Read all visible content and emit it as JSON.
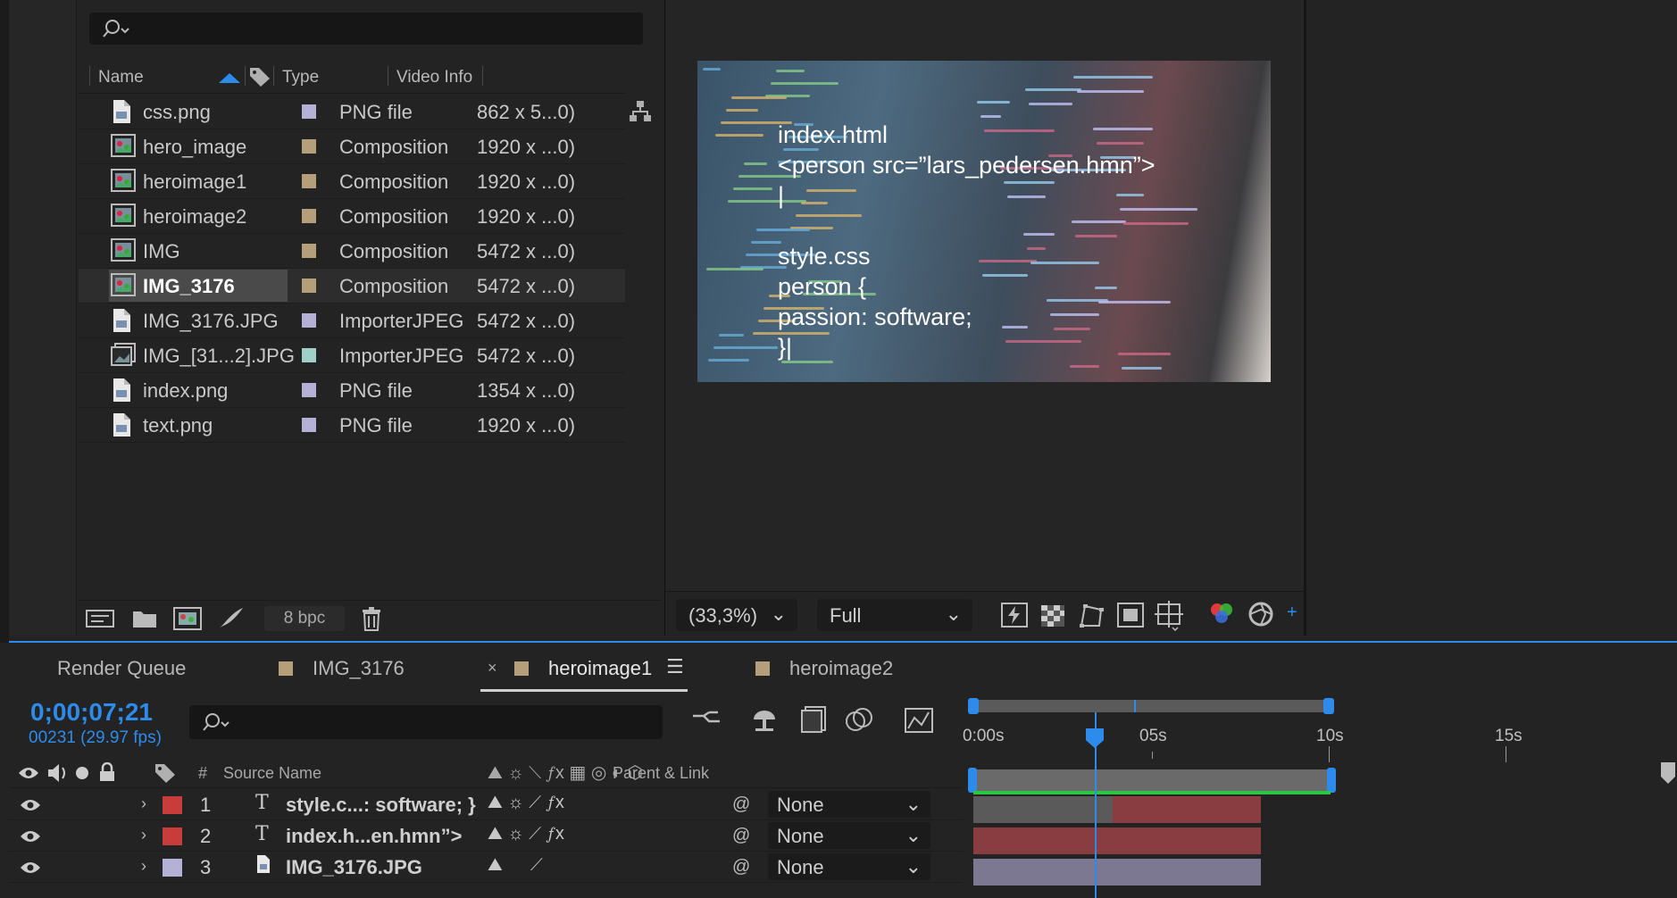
{
  "project": {
    "columns": {
      "name": "Name",
      "type": "Type",
      "video_info": "Video Info"
    },
    "items": [
      {
        "name": "css.png",
        "type": "PNG file",
        "video_info": "862 x 5...0)",
        "kind": "file",
        "color": "#b4b0d6"
      },
      {
        "name": "hero_image",
        "type": "Composition",
        "video_info": "1920 x ...0)",
        "kind": "comp",
        "color": "#b59f7a"
      },
      {
        "name": "heroimage1",
        "type": "Composition",
        "video_info": "1920 x ...0)",
        "kind": "comp",
        "color": "#b59f7a"
      },
      {
        "name": "heroimage2",
        "type": "Composition",
        "video_info": "1920 x ...0)",
        "kind": "comp",
        "color": "#b59f7a"
      },
      {
        "name": "IMG",
        "type": "Composition",
        "video_info": "5472 x ...0)",
        "kind": "comp",
        "color": "#b59f7a"
      },
      {
        "name": "IMG_3176",
        "type": "Composition",
        "video_info": "5472 x ...0)",
        "kind": "comp",
        "color": "#b59f7a",
        "selected": true
      },
      {
        "name": "IMG_3176.JPG",
        "type": "ImporterJPEG",
        "video_info": "5472 x ...0)",
        "kind": "file",
        "color": "#b4b0d6"
      },
      {
        "name": "IMG_[31...2].JPG",
        "type": "ImporterJPEG",
        "video_info": "5472 x ...0)",
        "kind": "sequence",
        "color": "#9fd0c8"
      },
      {
        "name": "index.png",
        "type": "PNG file",
        "video_info": "1354 x ...0)",
        "kind": "file",
        "color": "#b4b0d6"
      },
      {
        "name": "text.png",
        "type": "PNG file",
        "video_info": "1920 x ...0)",
        "kind": "file",
        "color": "#b4b0d6"
      }
    ],
    "bpc": "8 bpc"
  },
  "viewer": {
    "comp_text": "index.html\n<person src=”lars_pedersen.hmn”>\n|\n\nstyle.css\nperson {\npassion: software;\n}|",
    "zoom": "(33,3%)",
    "resolution": "Full"
  },
  "timeline": {
    "tabs": [
      {
        "label": "Render Queue"
      },
      {
        "label": "IMG_3176"
      },
      {
        "label": "heroimage1",
        "active": true
      },
      {
        "label": "heroimage2"
      }
    ],
    "timecode": "0;00;07;21",
    "fps": "00231 (29.97 fps)",
    "headers": {
      "hash": "#",
      "source_name": "Source Name",
      "parent_link": "Parent & Link"
    },
    "ruler_labels": [
      "0:00s",
      "05s",
      "10s",
      "15s"
    ],
    "layers": [
      {
        "num": "1",
        "name": "style.c...: software; }",
        "type_icon": "T",
        "label_color": "#c83c3c",
        "parent": "None",
        "fx": true
      },
      {
        "num": "2",
        "name": "index.h...en.hmn”>",
        "type_icon": "T",
        "label_color": "#c83c3c",
        "parent": "None",
        "fx": true
      },
      {
        "num": "3",
        "name": "IMG_3176.JPG",
        "type_icon": "file",
        "label_color": "#b4b0d6",
        "parent": "None",
        "fx": false
      }
    ]
  }
}
